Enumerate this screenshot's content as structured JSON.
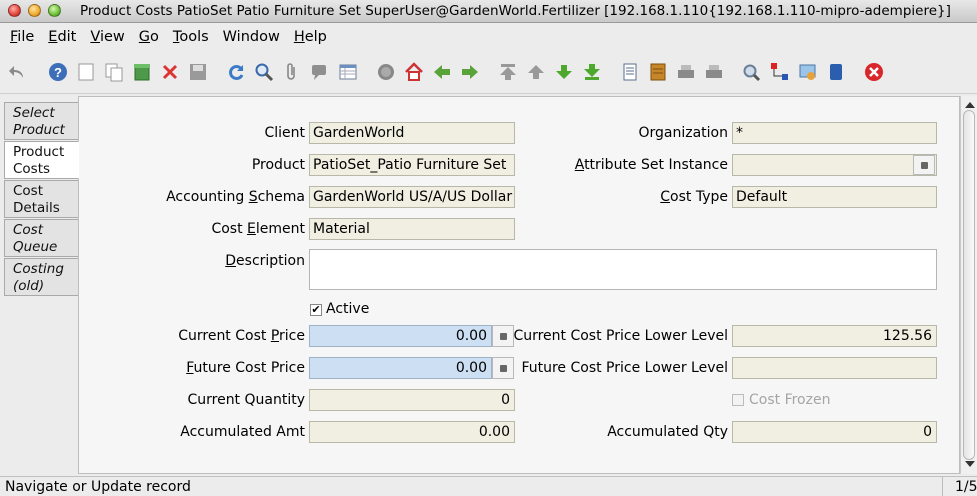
{
  "window": {
    "title": "Product Costs  PatioSet  Patio Furniture Set  SuperUser@GardenWorld.Fertilizer [192.168.1.110{192.168.1.110-mipro-adempiere}]"
  },
  "menu": {
    "file": "File",
    "file_u": "F",
    "file_rest": "ile",
    "edit_u": "E",
    "edit_rest": "dit",
    "view_u": "V",
    "view_rest": "iew",
    "go_u": "G",
    "go_rest": "o",
    "tools_u": "T",
    "tools_rest": "ools",
    "window": "Window",
    "help_u": "H",
    "help_rest": "elp"
  },
  "toolbar": {
    "icons": [
      "undo-icon",
      "help-icon",
      "new-record-icon",
      "copy-record-icon",
      "delete-all-icon",
      "delete-icon",
      "save-icon",
      "refresh-icon",
      "find-icon",
      "attachment-icon",
      "chat-icon",
      "grid-toggle-icon",
      "history-icon",
      "home-icon",
      "back-icon",
      "forward-icon",
      "first-record-icon",
      "previous-record-icon",
      "next-record-icon",
      "last-record-icon",
      "report-icon",
      "archive-icon",
      "print-preview-icon",
      "print-icon",
      "zoom-across-icon",
      "workflow-icon",
      "request-icon",
      "product-info-icon",
      "close-window-icon"
    ]
  },
  "tabs": [
    {
      "line1": "Select",
      "line2": "Product"
    },
    {
      "line1": "Product",
      "line2": "Costs"
    },
    {
      "line1": "Cost",
      "line2": "Details"
    },
    {
      "line1": "Cost",
      "line2": "Queue"
    },
    {
      "line1": "Costing",
      "line2": "(old)"
    }
  ],
  "form": {
    "client_label": "Client",
    "client_value": "GardenWorld",
    "org_label": "Organization",
    "org_value": "*",
    "product_label": "Product",
    "product_value": "PatioSet_Patio Furniture Set",
    "asi_label_u": "A",
    "asi_label_rest": "ttribute Set Instance",
    "asi_value": "",
    "schema_label_pre": "Accounting ",
    "schema_label_u": "S",
    "schema_label_rest": "chema",
    "schema_value": "GardenWorld US/A/US Dollar",
    "costtype_label_u": "C",
    "costtype_label_rest": "ost Type",
    "costtype_value": "Default",
    "element_label_pre": "Cost ",
    "element_label_u": "E",
    "element_label_rest": "lement",
    "element_value": "Material",
    "desc_label_u": "D",
    "desc_label_rest": "escription",
    "desc_value": "",
    "active_label": "Active",
    "active_checked": "✔",
    "ccp_label_pre": "Current Cost ",
    "ccp_label_u": "P",
    "ccp_label_rest": "rice",
    "ccp_value": "0.00",
    "ccpll_label": "Current Cost Price Lower Level",
    "ccpll_value": "125.56",
    "fcp_label_u": "F",
    "fcp_label_rest": "uture Cost Price",
    "fcp_value": "0.00",
    "fcpll_label": "Future Cost Price Lower Level",
    "fcpll_value": "",
    "cq_label": "Current Quantity",
    "cq_value": "0",
    "frozen_label": "Cost Frozen",
    "aamt_label": "Accumulated Amt",
    "aamt_value": "0.00",
    "aqty_label": "Accumulated Qty",
    "aqty_value": "0"
  },
  "status": {
    "message": "Navigate or Update record",
    "count": "1/5"
  }
}
